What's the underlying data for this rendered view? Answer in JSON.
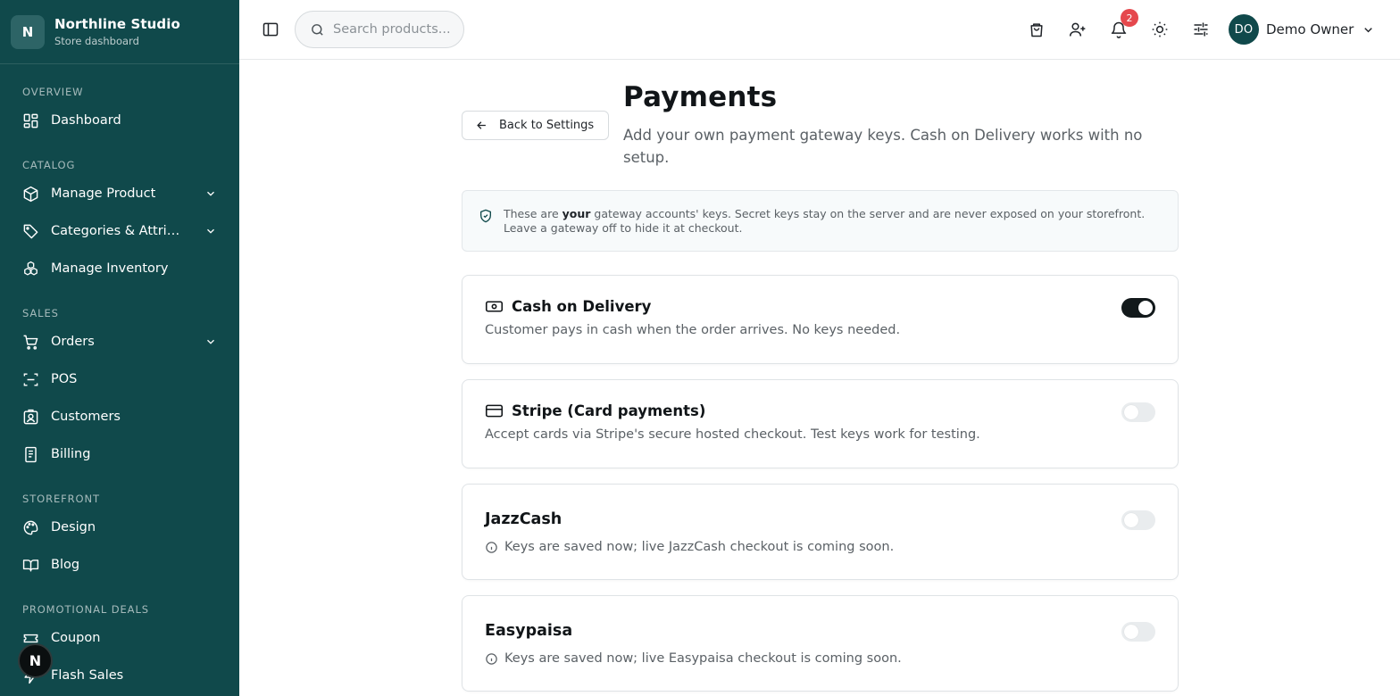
{
  "brand": {
    "initial": "N",
    "name": "Northline Studio",
    "subtitle": "Store dashboard"
  },
  "sidebar": {
    "sections": [
      {
        "label": "OVERVIEW",
        "items": [
          {
            "label": "Dashboard",
            "icon": "dashboard-grid-icon"
          }
        ]
      },
      {
        "label": "CATALOG",
        "items": [
          {
            "label": "Manage Product",
            "icon": "box-icon",
            "expandable": true
          },
          {
            "label": "Categories & Attributes",
            "icon": "tag-icon",
            "expandable": true
          },
          {
            "label": "Manage Inventory",
            "icon": "boxes-icon"
          }
        ]
      },
      {
        "label": "SALES",
        "items": [
          {
            "label": "Orders",
            "icon": "cart-icon",
            "expandable": true
          },
          {
            "label": "POS",
            "icon": "scan-icon"
          },
          {
            "label": "Customers",
            "icon": "customer-badge-icon"
          },
          {
            "label": "Billing",
            "icon": "receipt-icon"
          }
        ]
      },
      {
        "label": "STOREFRONT",
        "items": [
          {
            "label": "Design",
            "icon": "palette-icon"
          },
          {
            "label": "Blog",
            "icon": "book-icon"
          }
        ]
      },
      {
        "label": "PROMOTIONAL DEALS",
        "items": [
          {
            "label": "Coupon",
            "icon": "ticket-icon"
          },
          {
            "label": "Flash Sales",
            "icon": "zap-icon"
          }
        ]
      }
    ],
    "floating_badge": "N"
  },
  "header": {
    "search_placeholder": "Search products...",
    "notification_count": "2",
    "user": {
      "initials": "DO",
      "name": "Demo Owner"
    }
  },
  "page": {
    "back_label": "Back to Settings",
    "title": "Payments",
    "subtitle": "Add your own payment gateway keys. Cash on Delivery works with no setup."
  },
  "info": {
    "prefix": "These are ",
    "emphasis": "your",
    "suffix": " gateway accounts' keys. Secret keys stay on the server and are never exposed on your storefront. Leave a gateway off to hide it at checkout."
  },
  "gateways": [
    {
      "name": "Cash on Delivery",
      "icon": "banknote-icon",
      "description": "Customer pays in cash when the order arrives. No keys needed.",
      "enabled": true
    },
    {
      "name": "Stripe (Card payments)",
      "icon": "credit-card-icon",
      "description": "Accept cards via Stripe's secure hosted checkout. Test keys work for testing.",
      "enabled": false
    },
    {
      "name": "JazzCash",
      "icon": "",
      "description": "Keys are saved now; live JazzCash checkout is coming soon.",
      "enabled": false
    },
    {
      "name": "Easypaisa",
      "icon": "",
      "description": "Keys are saved now; live Easypaisa checkout is coming soon.",
      "enabled": false
    }
  ],
  "colors": {
    "sidebar_bg": "#10494b",
    "accent": "#10494b",
    "badge": "#e5484d",
    "toggle_on": "#12191b"
  }
}
